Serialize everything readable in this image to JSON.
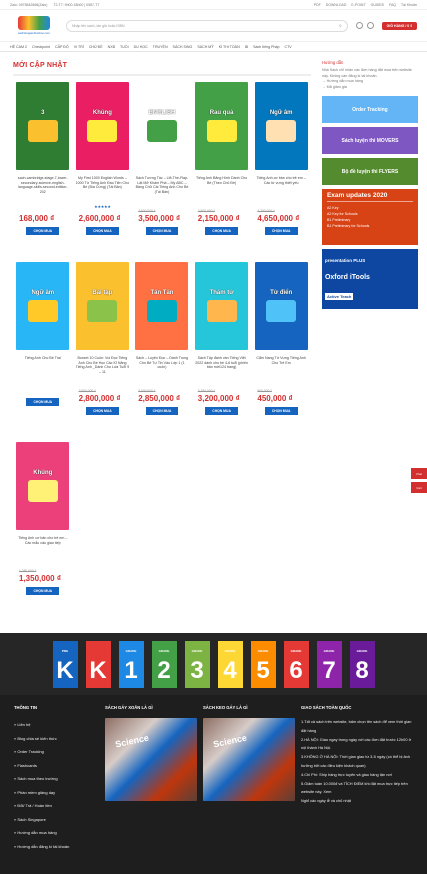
{
  "topbar": {
    "contact": "Zalo: 0975842868(Zalo)",
    "time": "T2-T7: 9h00-18h00 | 0987-TT",
    "links": [
      "PDF",
      "DOWNLOAD",
      "E-POINT",
      "GUIDES",
      "FAQ",
      "Tài Khoản"
    ]
  },
  "header": {
    "logo_text": "sachtiengannhanhoc.com",
    "search_placeholder": "Nhập tên sách, tác giả hoặc ISBN",
    "cart_label": "GIỎ HÀNG / 0 ₫"
  },
  "nav": [
    "HỆ CAM 2",
    "Checkpoint",
    "CẤP ĐỘ",
    "VI TRÍ",
    "CHỦ ĐỀ",
    "NXB",
    "TUỔI",
    "DU HỌC",
    "TRUYỆN",
    "SÁCH SING",
    "SÁCH MỸ",
    "KÌ THI TOÀN",
    "IB",
    "Sách tiếng Pháp",
    "CTV"
  ],
  "section_title": "MỚI CẬP NHẬT",
  "products": [
    {
      "title": "sach-cambridge-stage-7-lower-secondary-science-english-language-skills-second-edition-202",
      "old": "",
      "price": "168,000 ₫",
      "stars": "",
      "img": "#2e7d32",
      "img2": "#fbc02d",
      "label": "3"
    },
    {
      "title": "My First 1000 English Words – 1000 Từ Tiếng Anh Đầu Tiên Cho Bé (Bìa Cứng) (Tái Bản)",
      "old": "",
      "price": "2,600,000 ₫",
      "stars": "★★★★★",
      "img": "#e91e63",
      "img2": "#ffeb3b",
      "label": "Khủng"
    },
    {
      "title": "Sách Tương Tác – Lift-The-Flap-Lật Mở Khám Phá – My ABC – Bảng Chữ Cái Tiếng Anh Cho Bé (Tái Bản)",
      "old": "3,600,000 ₫",
      "price": "3,500,000 ₫",
      "stars": "",
      "img": "#ffffff",
      "img2": "#43a047",
      "label": "ENGLISH"
    },
    {
      "title": "Tiếng Anh Bằng Hình Dành Cho Bé (Theo Chủ Đề)",
      "old": "2,500,000 ₫",
      "price": "2,150,000 ₫",
      "stars": "",
      "img": "#43a047",
      "img2": "#ffeb3b",
      "label": "Rau quả"
    },
    {
      "title": "Tiếng Anh cơ bản cho trẻ em – Các từ vựng thiết yếu",
      "old": "4,750,000 ₫",
      "price": "4,650,000 ₫",
      "stars": "",
      "img": "#0277bd",
      "img2": "#ffe0b2",
      "label": "Ngữ âm"
    },
    {
      "title": "Tiếng Anh Cho Bé Trai",
      "old": "",
      "price": "",
      "stars": "",
      "img": "#29b6f6",
      "img2": "#ffca28",
      "label": "Ngữ âm"
    },
    {
      "title": "Boxset 10 Cuốn: Vui Đọc Tiếng Anh Cho Bé Học Các Kĩ Năng Tiếng Anh _Dành Cho Lứa Tuổi 9 – 11",
      "old": "2,900,000 ₫",
      "price": "2,800,000 ₫",
      "stars": "",
      "img": "#fbc02d",
      "img2": "#8bc34a",
      "label": "Bài tập"
    },
    {
      "title": "Sách – Luyện Đọc – Dành Trong Cho Bé Tự Tin Vào Lớp 1 (1 cuốn)",
      "old": "3,000,000 ₫",
      "price": "2,850,000 ₫",
      "stars": "",
      "img": "#ff7043",
      "img2": "#00acc1",
      "label": "Tấn Tấn"
    },
    {
      "title": "Sách Tập đánh vần Tiếng Việt 2022 dành cho bé 4-6 tuổi (phiên bản mới124 trang)",
      "old": "3,250,000 ₫",
      "price": "3,200,000 ₫",
      "stars": "",
      "img": "#26c6da",
      "img2": "#ffb74d",
      "label": "Thám tử"
    },
    {
      "title": "Cẩm Nang Từ Vựng Tiếng Anh Cho Trẻ Em",
      "old": "500,000 ₫",
      "price": "450,000 ₫",
      "stars": "",
      "img": "#1565c0",
      "img2": "#4fc3f7",
      "label": "Từ điển"
    },
    {
      "title": "Tiếng Anh cơ bản cho trẻ em – Các mẫu câu giao tiếp",
      "old": "1,380,000 ₫",
      "price": "1,350,000 ₫",
      "stars": "",
      "img": "#ec407a",
      "img2": "#fff176",
      "label": "Khủng"
    }
  ],
  "buy_label": "CHỌN MUA",
  "sidebar": {
    "title": "Hướng dẫn",
    "lines": [
      "Nhà Sách chỉ nhận các đơn hàng đặt mua trên website này. Không cần đăng kí tài khoản.",
      "→ Hướng dẫn mua hàng",
      "→ Mã giảm giá"
    ],
    "banners": [
      "Order Tracking",
      "Sách luyện thi MOVERS",
      "Bộ đề luyện thi FLYERS"
    ],
    "exam": {
      "title": "Exam updates 2020",
      "items": [
        "A2 Key",
        "A2 Key for Schools",
        "B1 Preliminary",
        "B1 Preliminary for Schools"
      ]
    },
    "presentation": "presentation PLUS",
    "oxford": "Oxford iTools",
    "active": "Active Teach"
  },
  "side_icons": [
    "Chat",
    "Cart"
  ],
  "grades": [
    {
      "label": "PRE",
      "value": "K",
      "color": "#1565c0"
    },
    {
      "label": "",
      "value": "K",
      "color": "#e53935"
    },
    {
      "label": "GRADE",
      "value": "1",
      "color": "#1e88e5"
    },
    {
      "label": "GRADE",
      "value": "2",
      "color": "#43a047"
    },
    {
      "label": "GRADE",
      "value": "3",
      "color": "#7cb342"
    },
    {
      "label": "GRADE",
      "value": "4",
      "color": "#fdd835"
    },
    {
      "label": "GRADE",
      "value": "5",
      "color": "#fb8c00"
    },
    {
      "label": "GRADE",
      "value": "6",
      "color": "#e53935"
    },
    {
      "label": "GRADE",
      "value": "7",
      "color": "#8e24aa"
    },
    {
      "label": "GRADE",
      "value": "8",
      "color": "#6a1b9a"
    }
  ],
  "footer": {
    "col1": {
      "title": "THÔNG TIN",
      "items": [
        "» Liên hệ",
        "» Blog chia sẻ kiến thức",
        "» Order Tracking",
        "» Flashcards",
        "» Sách mua theo trường",
        "» Phần mềm giảng dạy",
        "» Đổi/ Trả / Hoàn tiền",
        "» Sách Singapore",
        "» Hướng dẫn mua hàng",
        "» Hướng dẫn đăng kí tài khoản"
      ]
    },
    "col2": {
      "title": "SÁCH GÁY XOẮN LÀ GÌ",
      "img_text": "Science"
    },
    "col3": {
      "title": "SÁCH KEO GÁY LÀ GÌ",
      "img_text": "Science"
    },
    "col4": {
      "title": "GIAO SÁCH TOÀN QUỐC",
      "lines": [
        "1.Tất cả sách trên website, bấm chọn tên sách để xem thời gian đặt hàng",
        "2.HÀ NỘI: Giao ngay trong ngày với các đơn đặt trước 12h00 ở nội thành Hà Nội.",
        "3.KHÔNG Ở HÀ NỘI: Thời gian giao từ 3-5 ngày (có thể bị ảnh hưởng bởi các điều kiện khách quan)",
        "4.Chi Phí: Ship hàng trực tuyến và giao hàng tận nơi",
        "5.Giảm tuần 10.000đ và TÍCH ĐIỂM khi đặt mua trực tiếp trên website này. Xem",
        "Nghỉ các ngày lễ và chủ nhật"
      ]
    }
  }
}
